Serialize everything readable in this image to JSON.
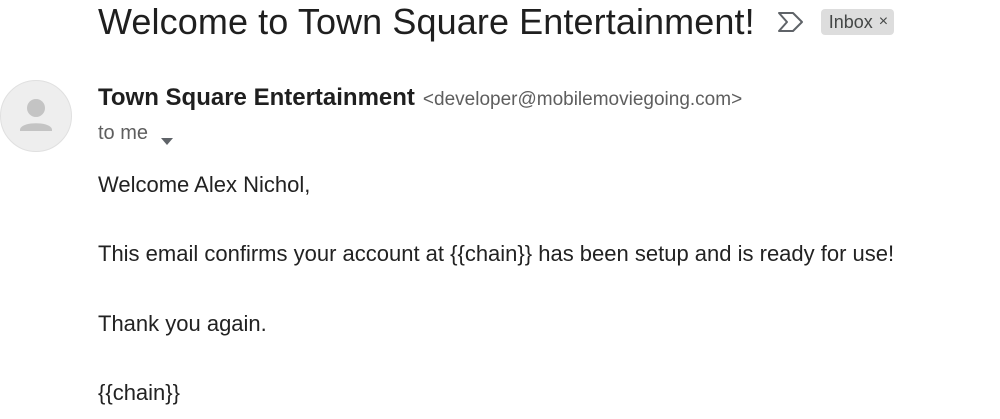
{
  "email": {
    "subject": "Welcome to Town Square Entertainment!",
    "label": "Inbox",
    "label_close": "×",
    "sender_name": "Town Square Entertainment",
    "sender_email": "<developer@mobilemoviegoing.com>",
    "recipient": "to me",
    "body": {
      "greeting": "Welcome Alex Nichol,",
      "paragraph1": "This email confirms your account at {{chain}} has been setup and is ready for use!",
      "paragraph2": "Thank you again.",
      "signature": "{{chain}}"
    }
  },
  "icons": {
    "important": "importance-marker-icon",
    "avatar": "default-avatar-icon",
    "caret": "caret-down-icon"
  },
  "colors": {
    "label_chip_bg": "#dddddd",
    "avatar_bg": "#eeeeee",
    "avatar_glyph": "#c4c4c4"
  }
}
